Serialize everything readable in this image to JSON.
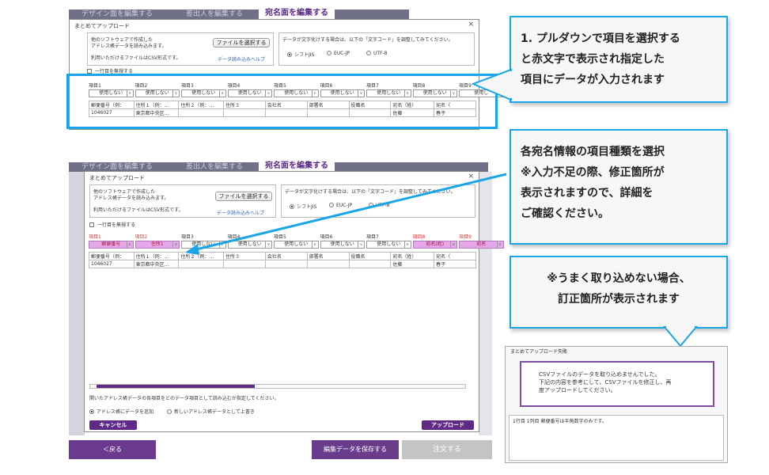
{
  "top_screen": {
    "tabs": [
      "デザイン面を編集する",
      "差出人を編集する",
      "宛名面を編集する"
    ],
    "dialog_title": "まとめてアップロード",
    "close": "×",
    "intro_text": "他のソフトウェアで作成した\nアドレス帳データを読み込みます。",
    "csv_note": "利用いただけるファイルはCSV形式です。",
    "file_button": "ファイルを選択する",
    "help_link": "データ読み込みヘルプ",
    "encoding_note": "データが文字化けする場合は、以下の「文字コード」を調整してみてください。",
    "encodings": [
      "シフトJIS",
      "EUC-JP",
      "UTF-8"
    ],
    "skip_first_row": "一行目を無視する",
    "columns": [
      "項目1",
      "項目2",
      "項目3",
      "項目4",
      "項目5",
      "項目6",
      "項目7",
      "項目8",
      "項目9"
    ],
    "selects": [
      "使用しない",
      "使用しない",
      "使用しない",
      "使用しない",
      "使用しない",
      "使用しない",
      "使用しない",
      "使用しない",
      "使用し"
    ],
    "row1": [
      "郵便番号（例：",
      "住所１（例：…",
      "住所２（例：…",
      "住所３",
      "会社名",
      "部署名",
      "役職名",
      "宛名（姓）",
      "宛名（"
    ],
    "row2": [
      "1046027",
      "東京都中央区…",
      "",
      "",
      "",
      "",
      "",
      "佐藤",
      "春子"
    ]
  },
  "main_screen": {
    "tabs": [
      "デザイン面を編集する",
      "差出人を編集する",
      "宛名面を編集する"
    ],
    "dialog_title": "まとめてアップロード",
    "close": "×",
    "intro_text": "他のソフトウェアで作成した\nアドレス帳データを読み込みます。",
    "csv_note": "利用いただけるファイルはCSV形式です。",
    "file_button": "ファイルを選択する",
    "help_link": "データ読み込みヘルプ",
    "encoding_note": "データが文字化けする場合は、以下の「文字コード」を調整してみてください。",
    "encodings": [
      "シフトJIS",
      "EUC-JP",
      "UTF-8"
    ],
    "skip_first_row": "一行目を無視する",
    "columns": [
      "項目1",
      "項目2",
      "項目3",
      "項目4",
      "項目5",
      "項目6",
      "項目7",
      "項目8",
      "項目9"
    ],
    "selects": [
      "郵便番号",
      "住所1",
      "使用しない",
      "使用しない",
      "使用しない",
      "使用しない",
      "使用しない",
      "宛名(姓)",
      "宛名"
    ],
    "row1": [
      "郵便番号（例：",
      "住所１（例：…",
      "住所２（例：…",
      "住所３",
      "会社名",
      "部署名",
      "役職名",
      "宛名（姓）",
      "宛名（"
    ],
    "row2": [
      "1046027",
      "東京都中央区…",
      "",
      "",
      "",
      "",
      "",
      "佐藤",
      "春子"
    ],
    "assign_note": "開いたアドレス帳データの各項目をどのデータ項目として読み込むか指定してください。",
    "modes": [
      "アドレス帳にデータを追加",
      "新しいアドレス帳データとして上書き"
    ],
    "cancel": "キャンセル",
    "upload": "アップロード",
    "back": "＜戻る",
    "save": "編集データを保存する",
    "order": "注文する"
  },
  "callouts": {
    "c1": "1. プルダウンで項目を選択する\nと赤文字で表示され指定した\n項目にデータが入力されます",
    "c2": "各宛名情報の項目種類を選択\n※入力不足の際、修正箇所が\n表示されますので、詳細を\nご確認ください。",
    "c3": "※うまく取り込めない場合、\n訂正箇所が表示されます"
  },
  "error_dialog": {
    "title": "まとめてアップロード失敗",
    "message": "CSVファイルのデータを取り込めませんでした。\n下記の内容を参考にして、CSVファイルを修正し、再\n度アップロードしてください。",
    "detail": "1行目 1列目 郵便番号は半角数字のみです。"
  },
  "colors": {
    "accent": "#1aa5e6",
    "purple": "#5e2a86",
    "red": "#e23a3a"
  }
}
